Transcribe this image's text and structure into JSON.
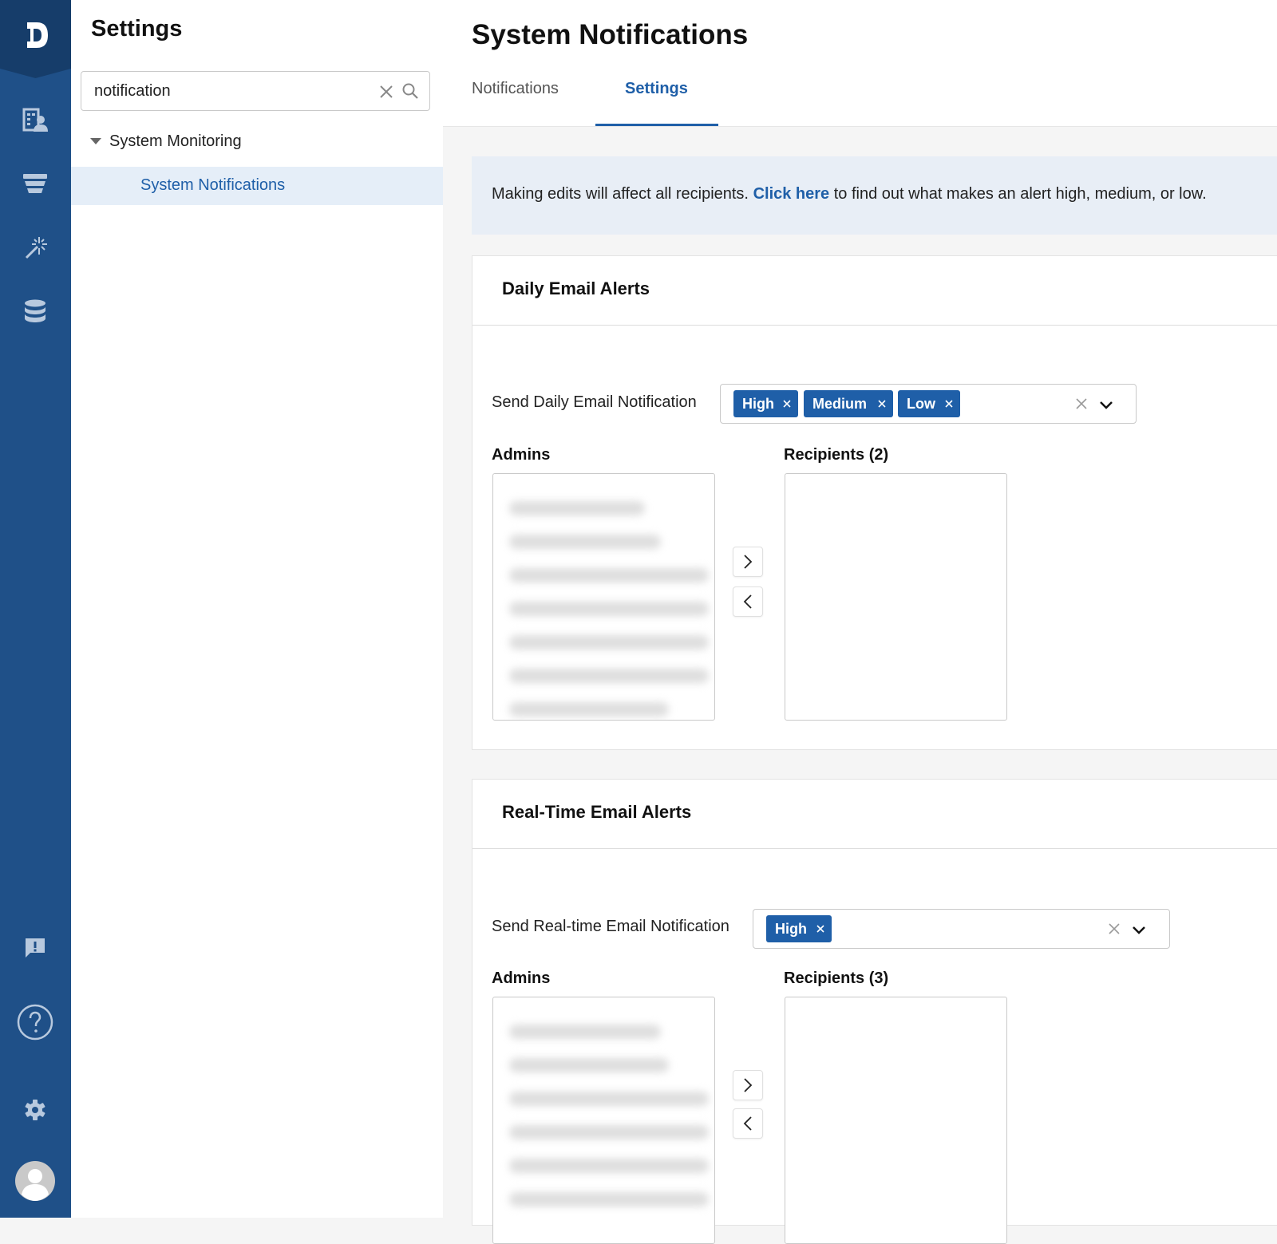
{
  "panel": {
    "title": "Settings",
    "search": {
      "value": "notification",
      "placeholder": "Search"
    },
    "tree": {
      "parent_label": "System Monitoring",
      "child_label": "System Notifications"
    }
  },
  "main": {
    "title": "System Notifications",
    "tabs": [
      {
        "label": "Notifications",
        "active": false
      },
      {
        "label": "Settings",
        "active": true
      }
    ],
    "banner": {
      "text_before": "Making edits will affect all recipients.",
      "link": "Click here",
      "text_after": "to find out what makes an alert high, medium, or low."
    },
    "daily": {
      "title": "Daily Email Alerts",
      "field_label": "Send Daily Email Notification",
      "chips": [
        "High",
        "Medium",
        "Low"
      ],
      "admins_label": "Admins",
      "recipients_label": "Recipients (2)"
    },
    "realtime": {
      "title": "Real-Time Email Alerts",
      "field_label": "Send Real-time Email Notification",
      "chips": [
        "High"
      ],
      "admins_label": "Admins",
      "recipients_label": "Recipients (3)"
    }
  },
  "colors": {
    "rail": "#1f5088",
    "accent": "#1f5fa8",
    "selected_row": "#e5eef8",
    "banner_bg": "#e8eef6"
  },
  "rail_icons": [
    "logo-icon",
    "reports-icon",
    "stack-icon",
    "magic-wand-icon",
    "database-icon",
    "feedback-icon",
    "help-icon",
    "gear-icon",
    "avatar-icon"
  ]
}
